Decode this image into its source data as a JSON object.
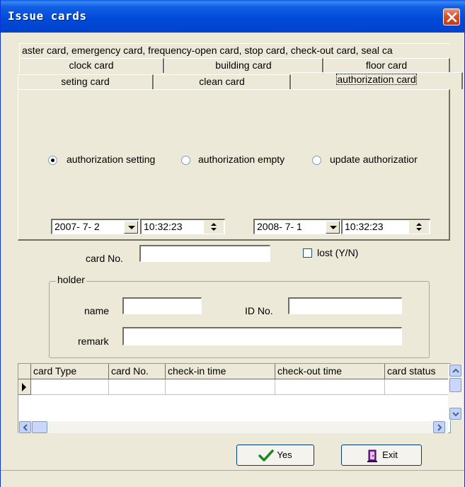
{
  "window": {
    "title": "Issue cards"
  },
  "tabs": {
    "row1": [
      "aster card, emergency card, frequency-open card, stop card, check-out card, seal ca"
    ],
    "row2": [
      "clock card",
      "building card",
      "floor card"
    ],
    "row3": [
      "seting card",
      "clean card",
      "authorization card"
    ]
  },
  "authorization": {
    "options": [
      "authorization setting",
      "authorization empty",
      "update authorizatior"
    ],
    "selected": "authorization setting",
    "start_date": "2007- 7- 2",
    "start_time": "10:32:23",
    "end_date": "2008- 7- 1",
    "end_time": "10:32:23"
  },
  "card": {
    "card_no_label": "card No.",
    "card_no_value": "",
    "lost_label": "lost (Y/N)"
  },
  "holder": {
    "title": "holder",
    "name_label": "name",
    "name_value": "",
    "id_label": "ID No.",
    "id_value": "",
    "remark_label": "remark",
    "remark_value": ""
  },
  "grid": {
    "columns": [
      "card Type",
      "card No.",
      "check-in time",
      "check-out time",
      "card status"
    ]
  },
  "buttons": {
    "yes": "Yes",
    "exit": "Exit"
  },
  "colors": {
    "titlebar": "#0043cc",
    "window": "#ece9d8",
    "close": "#d8502d"
  },
  "icons": [
    "close-icon",
    "checkmark-icon",
    "exit-door-icon",
    "chevron-up-icon",
    "chevron-down-icon",
    "chevron-left-icon",
    "chevron-right-icon"
  ]
}
